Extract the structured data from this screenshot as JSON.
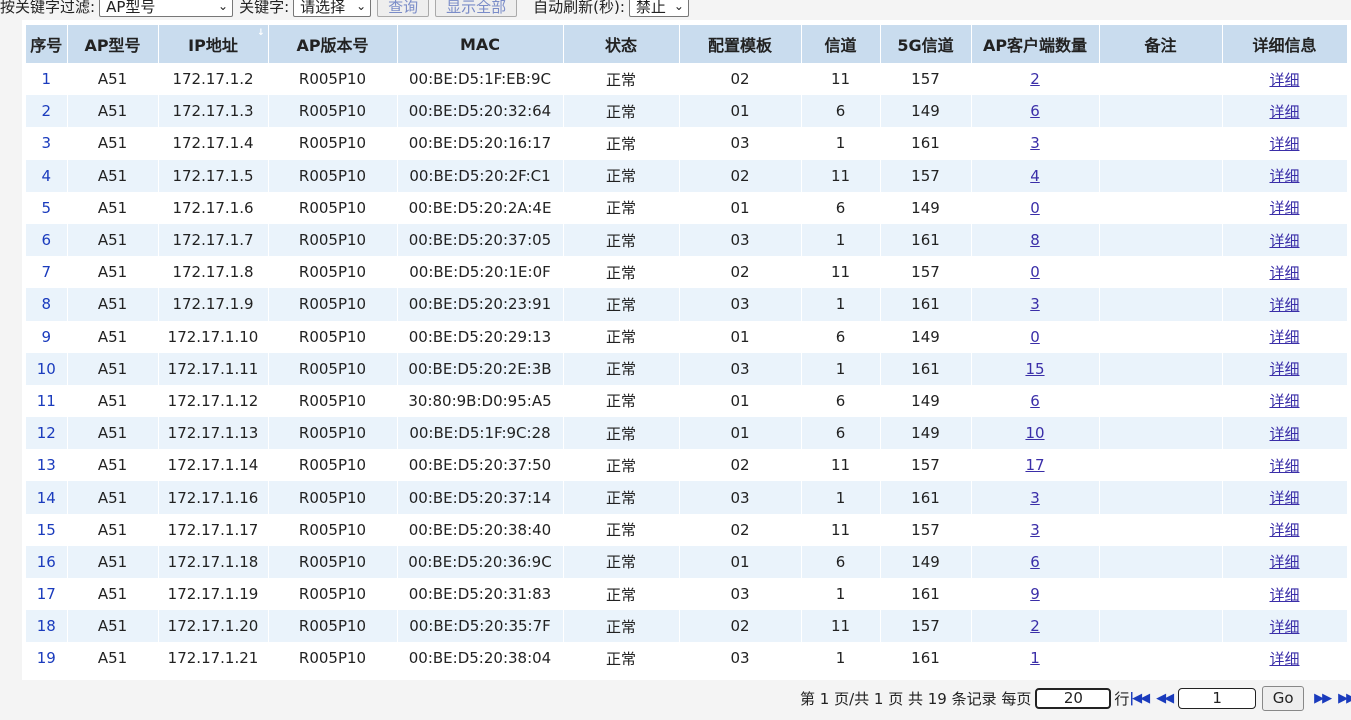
{
  "filter": {
    "keyword_filter_label": "按关键字过滤:",
    "field_select": "AP型号",
    "keyword_label": "关键字:",
    "keyword_select": "请选择",
    "query_button": "查询",
    "show_all_button": "显示全部",
    "auto_refresh_label": "自动刷新(秒):",
    "auto_refresh_select": "禁止"
  },
  "table": {
    "headers": [
      "序号",
      "AP型号",
      "IP地址",
      "AP版本号",
      "MAC",
      "状态",
      "配置模板",
      "信道",
      "5G信道",
      "AP客户端数量",
      "备注",
      "详细信息"
    ],
    "rows": [
      {
        "idx": "1",
        "model": "A51",
        "ip": "172.17.1.2",
        "ver": "R005P10",
        "mac": "00:BE:D5:1F:EB:9C",
        "status": "正常",
        "tpl": "02",
        "ch": "11",
        "ch5": "157",
        "clients": "2",
        "note": "",
        "detail": "详细"
      },
      {
        "idx": "2",
        "model": "A51",
        "ip": "172.17.1.3",
        "ver": "R005P10",
        "mac": "00:BE:D5:20:32:64",
        "status": "正常",
        "tpl": "01",
        "ch": "6",
        "ch5": "149",
        "clients": "6",
        "note": "",
        "detail": "详细"
      },
      {
        "idx": "3",
        "model": "A51",
        "ip": "172.17.1.4",
        "ver": "R005P10",
        "mac": "00:BE:D5:20:16:17",
        "status": "正常",
        "tpl": "03",
        "ch": "1",
        "ch5": "161",
        "clients": "3",
        "note": "",
        "detail": "详细"
      },
      {
        "idx": "4",
        "model": "A51",
        "ip": "172.17.1.5",
        "ver": "R005P10",
        "mac": "00:BE:D5:20:2F:C1",
        "status": "正常",
        "tpl": "02",
        "ch": "11",
        "ch5": "157",
        "clients": "4",
        "note": "",
        "detail": "详细"
      },
      {
        "idx": "5",
        "model": "A51",
        "ip": "172.17.1.6",
        "ver": "R005P10",
        "mac": "00:BE:D5:20:2A:4E",
        "status": "正常",
        "tpl": "01",
        "ch": "6",
        "ch5": "149",
        "clients": "0",
        "note": "",
        "detail": "详细"
      },
      {
        "idx": "6",
        "model": "A51",
        "ip": "172.17.1.7",
        "ver": "R005P10",
        "mac": "00:BE:D5:20:37:05",
        "status": "正常",
        "tpl": "03",
        "ch": "1",
        "ch5": "161",
        "clients": "8",
        "note": "",
        "detail": "详细"
      },
      {
        "idx": "7",
        "model": "A51",
        "ip": "172.17.1.8",
        "ver": "R005P10",
        "mac": "00:BE:D5:20:1E:0F",
        "status": "正常",
        "tpl": "02",
        "ch": "11",
        "ch5": "157",
        "clients": "0",
        "note": "",
        "detail": "详细"
      },
      {
        "idx": "8",
        "model": "A51",
        "ip": "172.17.1.9",
        "ver": "R005P10",
        "mac": "00:BE:D5:20:23:91",
        "status": "正常",
        "tpl": "03",
        "ch": "1",
        "ch5": "161",
        "clients": "3",
        "note": "",
        "detail": "详细"
      },
      {
        "idx": "9",
        "model": "A51",
        "ip": "172.17.1.10",
        "ver": "R005P10",
        "mac": "00:BE:D5:20:29:13",
        "status": "正常",
        "tpl": "01",
        "ch": "6",
        "ch5": "149",
        "clients": "0",
        "note": "",
        "detail": "详细"
      },
      {
        "idx": "10",
        "model": "A51",
        "ip": "172.17.1.11",
        "ver": "R005P10",
        "mac": "00:BE:D5:20:2E:3B",
        "status": "正常",
        "tpl": "03",
        "ch": "1",
        "ch5": "161",
        "clients": "15",
        "note": "",
        "detail": "详细"
      },
      {
        "idx": "11",
        "model": "A51",
        "ip": "172.17.1.12",
        "ver": "R005P10",
        "mac": "30:80:9B:D0:95:A5",
        "status": "正常",
        "tpl": "01",
        "ch": "6",
        "ch5": "149",
        "clients": "6",
        "note": "",
        "detail": "详细"
      },
      {
        "idx": "12",
        "model": "A51",
        "ip": "172.17.1.13",
        "ver": "R005P10",
        "mac": "00:BE:D5:1F:9C:28",
        "status": "正常",
        "tpl": "01",
        "ch": "6",
        "ch5": "149",
        "clients": "10",
        "note": "",
        "detail": "详细"
      },
      {
        "idx": "13",
        "model": "A51",
        "ip": "172.17.1.14",
        "ver": "R005P10",
        "mac": "00:BE:D5:20:37:50",
        "status": "正常",
        "tpl": "02",
        "ch": "11",
        "ch5": "157",
        "clients": "17",
        "note": "",
        "detail": "详细"
      },
      {
        "idx": "14",
        "model": "A51",
        "ip": "172.17.1.16",
        "ver": "R005P10",
        "mac": "00:BE:D5:20:37:14",
        "status": "正常",
        "tpl": "03",
        "ch": "1",
        "ch5": "161",
        "clients": "3",
        "note": "",
        "detail": "详细"
      },
      {
        "idx": "15",
        "model": "A51",
        "ip": "172.17.1.17",
        "ver": "R005P10",
        "mac": "00:BE:D5:20:38:40",
        "status": "正常",
        "tpl": "02",
        "ch": "11",
        "ch5": "157",
        "clients": "3",
        "note": "",
        "detail": "详细"
      },
      {
        "idx": "16",
        "model": "A51",
        "ip": "172.17.1.18",
        "ver": "R005P10",
        "mac": "00:BE:D5:20:36:9C",
        "status": "正常",
        "tpl": "01",
        "ch": "6",
        "ch5": "149",
        "clients": "6",
        "note": "",
        "detail": "详细"
      },
      {
        "idx": "17",
        "model": "A51",
        "ip": "172.17.1.19",
        "ver": "R005P10",
        "mac": "00:BE:D5:20:31:83",
        "status": "正常",
        "tpl": "03",
        "ch": "1",
        "ch5": "161",
        "clients": "9",
        "note": "",
        "detail": "详细"
      },
      {
        "idx": "18",
        "model": "A51",
        "ip": "172.17.1.20",
        "ver": "R005P10",
        "mac": "00:BE:D5:20:35:7F",
        "status": "正常",
        "tpl": "02",
        "ch": "11",
        "ch5": "157",
        "clients": "2",
        "note": "",
        "detail": "详细"
      },
      {
        "idx": "19",
        "model": "A51",
        "ip": "172.17.1.21",
        "ver": "R005P10",
        "mac": "00:BE:D5:20:38:04",
        "status": "正常",
        "tpl": "03",
        "ch": "1",
        "ch5": "161",
        "clients": "1",
        "note": "",
        "detail": "详细"
      }
    ]
  },
  "pager": {
    "summary": "第 1 页/共 1 页 共 19 条记录 每页",
    "per_page": "20",
    "rows_unit": "行",
    "page_input": "1",
    "go_button": "Go",
    "first_icon": "first-page-icon",
    "prev_icon": "prev-page-icon",
    "next_icon": "next-page-icon",
    "last_icon": "last-page-icon"
  },
  "colors": {
    "header_bg": "#c9dcee",
    "stripe_bg": "#eaf3fb",
    "link": "#3a2ea8",
    "index": "#1a3bbd"
  }
}
